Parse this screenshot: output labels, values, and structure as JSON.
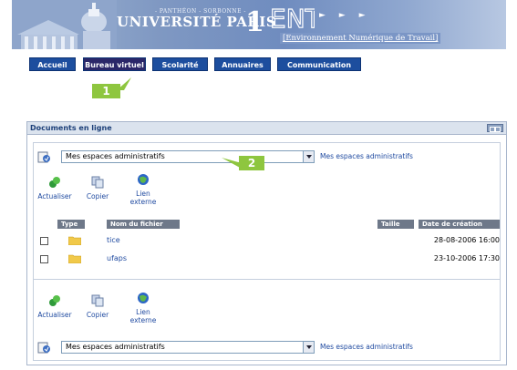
{
  "banner": {
    "pantheon": "- PANTHÉON - SORBONNE -",
    "univ": "UNIVERSITÉ PARIS",
    "univ_number": "1",
    "ent": "ENT",
    "ent_subtitle": "[Environnement Numérique de Travail]"
  },
  "nav": {
    "tabs": [
      {
        "label": "Accueil"
      },
      {
        "label": "Bureau virtuel"
      },
      {
        "label": "Scolarité"
      },
      {
        "label": "Annuaires"
      },
      {
        "label": "Communication"
      }
    ],
    "active": "Bureau virtuel"
  },
  "markers": {
    "one": "1",
    "two": "2"
  },
  "panel": {
    "title": "Documents en ligne",
    "space_select_value": "Mes espaces administratifs",
    "space_link": "Mes espaces administratifs",
    "actions": {
      "refresh": "Actualiser",
      "copy": "Copier",
      "link_line1": "Lien",
      "link_line2": "externe"
    },
    "table": {
      "headers": {
        "type": "Type",
        "name": "Nom du fichier",
        "size": "Taille",
        "date": "Date de création"
      },
      "rows": [
        {
          "name": "tice",
          "date": "28-08-2006 16:00"
        },
        {
          "name": "ufaps",
          "date": "23-10-2006 17:30"
        }
      ]
    }
  },
  "colors": {
    "nav_tab": "#1d4e9e",
    "nav_tab_active": "#2b2769",
    "marker": "#8ec63f",
    "link": "#1f4aa0"
  },
  "icons": [
    "document-icon",
    "refresh-icon",
    "copy-icon",
    "globe-link-icon",
    "folder-icon",
    "dropdown-arrow-icon"
  ]
}
